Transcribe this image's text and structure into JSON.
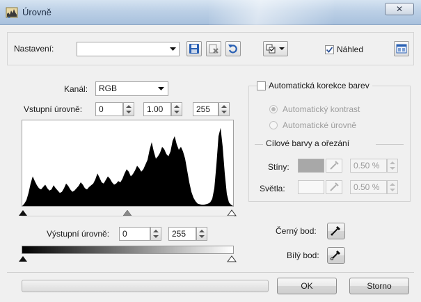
{
  "window": {
    "title": "Úrovně",
    "close_glyph": "✕",
    "icon": "levels-app-icon"
  },
  "preset": {
    "label": "Nastavení:",
    "value": "",
    "icons": [
      "save-icon",
      "delete-preset-icon",
      "reset-icon",
      "options-menu-icon"
    ]
  },
  "preview": {
    "label": "Náhled",
    "checked": true
  },
  "channel": {
    "label": "Kanál:",
    "value": "RGB"
  },
  "input_levels": {
    "label": "Vstupní úrovně:",
    "black": "0",
    "gamma": "1.00",
    "white": "255"
  },
  "output_levels": {
    "label": "Výstupní úrovně:",
    "black": "0",
    "white": "255"
  },
  "auto_correction": {
    "label": "Automatická korekce barev",
    "checked": false,
    "options": [
      {
        "label": "Automatický kontrast",
        "selected": true
      },
      {
        "label": "Automatické úrovně",
        "selected": false
      }
    ]
  },
  "target_colors": {
    "group_label": "Cílové barvy a ořezání",
    "shadows": {
      "label": "Stíny:",
      "swatch": "#a8a8a8",
      "value": "0.50 %"
    },
    "highlights": {
      "label": "Světla:",
      "swatch": "#f8f8f8",
      "value": "0.50 %"
    }
  },
  "points": {
    "black_label": "Černý bod:",
    "white_label": "Bílý bod:"
  },
  "buttons": {
    "ok": "OK",
    "cancel": "Storno"
  },
  "histogram": {
    "bins": [
      0,
      4,
      10,
      22,
      38,
      50,
      42,
      35,
      30,
      28,
      32,
      36,
      30,
      26,
      28,
      35,
      30,
      26,
      22,
      24,
      30,
      38,
      34,
      28,
      24,
      26,
      30,
      34,
      40,
      36,
      30,
      28,
      32,
      35,
      38,
      45,
      55,
      48,
      40,
      38,
      44,
      50,
      46,
      40,
      36,
      38,
      42,
      40,
      46,
      55,
      62,
      58,
      50,
      54,
      60,
      68,
      64,
      58,
      62,
      70,
      78,
      95,
      108,
      92,
      80,
      84,
      90,
      100,
      96,
      88,
      84,
      92,
      110,
      118,
      104,
      95,
      100,
      92,
      80,
      60,
      40,
      24,
      14,
      8,
      4,
      3,
      2,
      2,
      3,
      4,
      6,
      12,
      30,
      70,
      118,
      132,
      100,
      55,
      20,
      6,
      2,
      0
    ]
  }
}
